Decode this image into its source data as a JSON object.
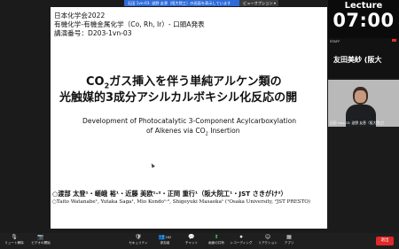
{
  "header": {
    "share_notice": "石田 1vn-03: 滋野 友恵（阪大院工）の画面を表示しています",
    "view_options": "ビューオプション ▾"
  },
  "slide": {
    "conference": "日本化学会2022",
    "session": "有機化学-有機金属化学（Co, Rh, Ir）- 口頭A発表",
    "talk_number": "講演番号：D203-1vn-03",
    "title_jp_line1_a": "CO",
    "title_jp_line1_sub": "2",
    "title_jp_line1_b": "ガス挿入を伴う単純アルケン類の",
    "title_jp_line2": "光触媒的3成分アシルカルボキシル化反応の開",
    "title_en_line1": "Development of Photocatalytic 3-Component Acylcarboxylation",
    "title_en_line2_a": "of Alkenes via CO",
    "title_en_line2_sub": "2",
    "title_en_line2_b": " Insertion",
    "authors_jp": "○渡部 太登¹・嵯峨 裕¹・近藤 美欧¹·²・正岡 重行¹（阪大院工¹・JST さきがけ²）",
    "authors_en": "○Taito Watanabe¹, Yutaka Saga¹, Mio Kondo¹·², Shigeyuki Masaoka¹ (¹Osaka University, ²JST PRESTO)"
  },
  "right_panel": {
    "lecture_label": "Lecture",
    "lecture_time": "07:00",
    "video1_label": "STAFF",
    "speaker_name": "友田美紗 (阪大",
    "video2_label": "石田 1vn-03: 滋野 友恵（阪大院工）"
  },
  "toolbar": {
    "mute": {
      "icon": "mic-icon",
      "label": "ミュート解除"
    },
    "video": {
      "icon": "video-camera-icon",
      "label": "ビデオの開始"
    },
    "security": {
      "icon": "shield-icon",
      "label": "セキュリティ"
    },
    "participants": {
      "icon": "people-icon",
      "label": "参加者",
      "count": "162"
    },
    "chat": {
      "icon": "chat-icon",
      "label": "チャット"
    },
    "share": {
      "icon": "share-screen-icon",
      "label": "画面の共有"
    },
    "record": {
      "icon": "record-icon",
      "label": "レコーディング"
    },
    "reactions": {
      "icon": "smiley-icon",
      "label": "リアクション"
    },
    "apps": {
      "icon": "apps-icon",
      "label": "アプリ"
    },
    "leave": "退出"
  },
  "colors": {
    "share_bar": "#2e6bd8",
    "share_icon": "#3ac26a",
    "leave": "#e02828"
  }
}
